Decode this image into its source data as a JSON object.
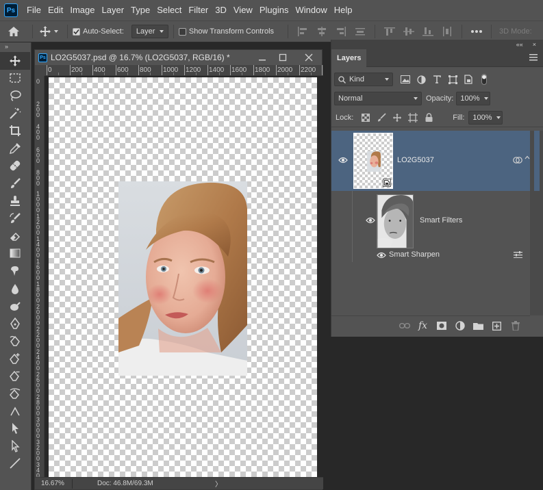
{
  "app": {
    "logo_text": "Ps"
  },
  "menu": [
    "File",
    "Edit",
    "Image",
    "Layer",
    "Type",
    "Select",
    "Filter",
    "3D",
    "View",
    "Plugins",
    "Window",
    "Help"
  ],
  "options_bar": {
    "auto_select_label": "Auto-Select:",
    "auto_select_checked": true,
    "auto_select_target": "Layer",
    "show_transform_label": "Show Transform Controls",
    "show_transform_checked": false,
    "mode_3d_label": "3D Mode:"
  },
  "toolbar": {
    "collapse_label": "»"
  },
  "document": {
    "icon_text": "Ps",
    "title": "LO2G5037.psd @ 16.7% (LO2G5037, RGB/16) *",
    "ruler_top_labels": [
      "0",
      "200",
      "400",
      "600",
      "800",
      "1000",
      "1200",
      "1400",
      "1600",
      "1800",
      "2000",
      "2200"
    ],
    "ruler_left_labels": [
      "0",
      "200",
      "400",
      "600",
      "800",
      "1000",
      "1200",
      "1400",
      "1600",
      "1800",
      "2000",
      "2200",
      "2400",
      "2600",
      "2800",
      "3000",
      "3200",
      "3400"
    ],
    "zoom": "16.67%",
    "doc_size": "Doc: 46.8M/69.3M",
    "status_arrow": "〉"
  },
  "panel": {
    "collapse_label": "««",
    "close_label": "×",
    "tab_label": "Layers",
    "filter_kind": "Kind",
    "blend_mode": "Normal",
    "opacity_label": "Opacity:",
    "opacity_value": "100%",
    "lock_label": "Lock:",
    "fill_label": "Fill:",
    "fill_value": "100%",
    "layers": [
      {
        "name": "LO2G5037",
        "selected": true,
        "visible": true,
        "smart_object": true
      },
      {
        "name": "Smart Filters",
        "visible": true
      },
      {
        "name": "Smart Sharpen",
        "visible": true
      }
    ]
  }
}
